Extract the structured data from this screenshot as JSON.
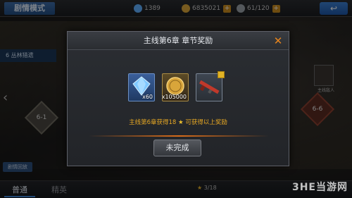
{
  "topbar": {
    "mode_title": "剧情模式",
    "resources": [
      {
        "icon": "diamond-icon",
        "value": "1389",
        "color": "#5fb0ff"
      },
      {
        "icon": "coin-icon",
        "value": "6835021",
        "color": "#d9a53a"
      },
      {
        "icon": "energy-icon",
        "value": "61/120",
        "color": "#9aa0a8"
      }
    ],
    "back_icon": "back-arrow-icon"
  },
  "map": {
    "stage_label": "6 丛林猎遗",
    "node_left": "6-1",
    "node_right": "6-6",
    "enemy_label": "主线敌人",
    "left_small_button": "剧情回放"
  },
  "dialog": {
    "title": "主线第6章 章节奖励",
    "close_icon": "close-icon",
    "rewards": [
      {
        "icon": "diamond-icon",
        "qty": "x60",
        "color": "#7fc8ff"
      },
      {
        "icon": "coin-icon",
        "qty": "x105000",
        "color": "#d9a53a"
      },
      {
        "icon": "rifle-icon",
        "qty": "",
        "color": "#c0392b"
      }
    ],
    "info_prefix": "主线第6章获得18",
    "info_star_icon": "star-icon",
    "info_suffix": "可获得以上奖励",
    "status_button": "未完成"
  },
  "bottombar": {
    "tabs": [
      "普通",
      "精英"
    ],
    "star_count": "3/18"
  },
  "watermark": "3HE当游网"
}
